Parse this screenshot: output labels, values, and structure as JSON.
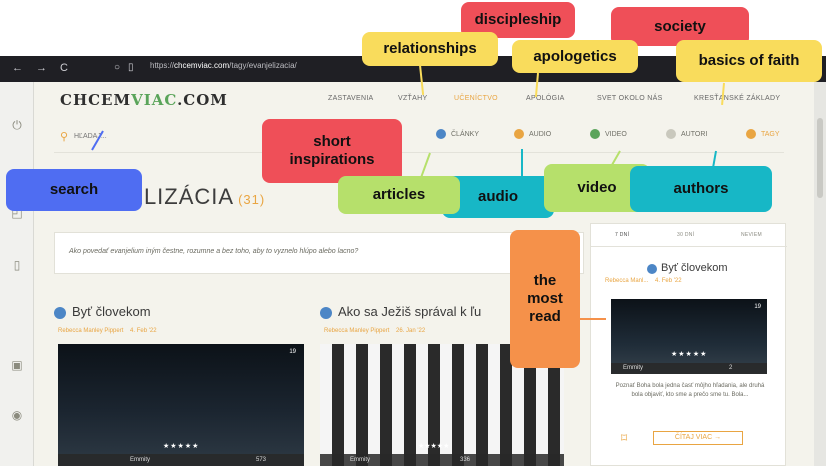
{
  "browser": {
    "back_icon": "←",
    "forward_icon": "→",
    "reload_icon": "C",
    "url_prefix": "https://",
    "url_host": "chcemviac.com",
    "url_path": "/tagy/evanjelizacia/"
  },
  "site": {
    "logo_left": "CHCEM",
    "logo_accent": "VIAC",
    "logo_right": ".COM",
    "main_nav": [
      "ZASTAVENIA",
      "VZŤAHY",
      "UČENÍCTVO",
      "APOLÓGIA",
      "SVET OKOLO NÁS",
      "KRESŤANSKÉ ZÁKLADY"
    ],
    "search_placeholder": "HĽADAJ...",
    "sub_nav": [
      "ČLÁNKY",
      "AUDIO",
      "VIDEO",
      "AUTORI",
      "TAGY"
    ]
  },
  "page": {
    "title": "EVANJELIZÁCIA",
    "count": "(31)",
    "intro": "Ako povedať evanjelium iným čestne, rozumne a bez toho, aby to vyznelo hlúpo alebo lacno?"
  },
  "cards": [
    {
      "title": "Byť človekom",
      "author": "Rebecca Manley Pippert",
      "date": "4. Feb '22",
      "shares": "19",
      "rating": "★★★★★",
      "stat_left": "Emmity",
      "stat_right": "573"
    },
    {
      "title": "Ako sa Ježiš správal k ľu",
      "author": "Rebecca Manley Pippert",
      "date": "26. Jan '22",
      "rating": "★★★★★",
      "stat_left": "Emmity",
      "stat_right": "336"
    }
  ],
  "rail": {
    "tabs": [
      "7 DNÍ",
      "30 DNÍ",
      "NEVIEM"
    ],
    "title": "Byť človekom",
    "author": "Rebecca Manl...",
    "date": "4. Feb '22",
    "shares": "19",
    "rating": "★★★★★",
    "stat_left": "Emmity",
    "stat_right": "2",
    "excerpt": "Poznať Boha bola jedna časť môjho hľadania, ale druhá bola objaviť, kto sme a prečo sme tu. Bola...",
    "button": "ČÍTAJ VIAC →"
  },
  "annotations": {
    "discipleship": "discipleship",
    "society": "society",
    "relationships": "relationships",
    "apologetics": "apologetics",
    "basics_of_faith": "basics of faith",
    "short_inspirations_1": "short",
    "short_inspirations_2": "inspirations",
    "search": "search",
    "articles": "articles",
    "audio": "audio",
    "video": "video",
    "authors": "authors",
    "most_read_1": "the",
    "most_read_2": "most",
    "most_read_3": "read"
  },
  "colors": {
    "accent": "#e9a542",
    "callout_yellow": "#f9dc5c",
    "callout_red": "#ef4f58",
    "callout_green": "#b6e06b",
    "callout_teal": "#17b7c6",
    "callout_blue": "#4f6df2",
    "callout_orange": "#f5914a"
  }
}
